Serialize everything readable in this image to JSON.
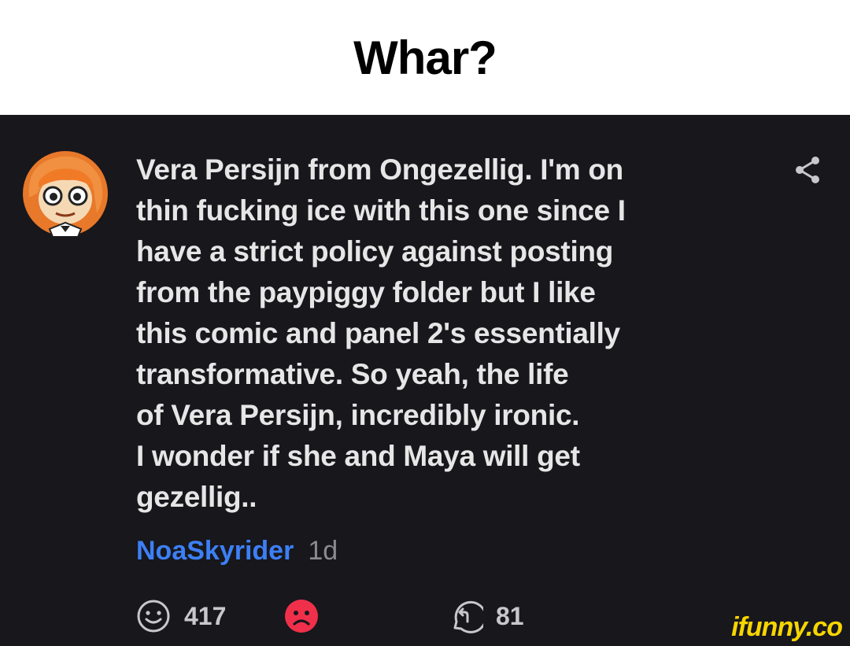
{
  "caption": {
    "title": "Whar?"
  },
  "comment": {
    "lines": [
      "Vera Persijn from Ongezellig. I'm on",
      "thin fucking ice with this one since I",
      "have a strict policy against posting",
      "from the paypiggy folder but I like",
      "this comic and panel 2's essentially",
      "transformative. So yeah, the life",
      "of Vera Persijn, incredibly ironic.",
      "I wonder if she and Maya will get",
      "gezellig.."
    ],
    "username": "NoaSkyrider",
    "age": "1d",
    "username_color": "#3d7ff5"
  },
  "actions": {
    "smile_count": "417",
    "reply_count": "81",
    "frown_color": "#f0304a"
  },
  "icons": [
    "avatar",
    "share-icon",
    "smile-icon",
    "frown-icon",
    "reply-icon"
  ],
  "watermark": {
    "text": "ifunny.co",
    "color": "#f7d500"
  }
}
